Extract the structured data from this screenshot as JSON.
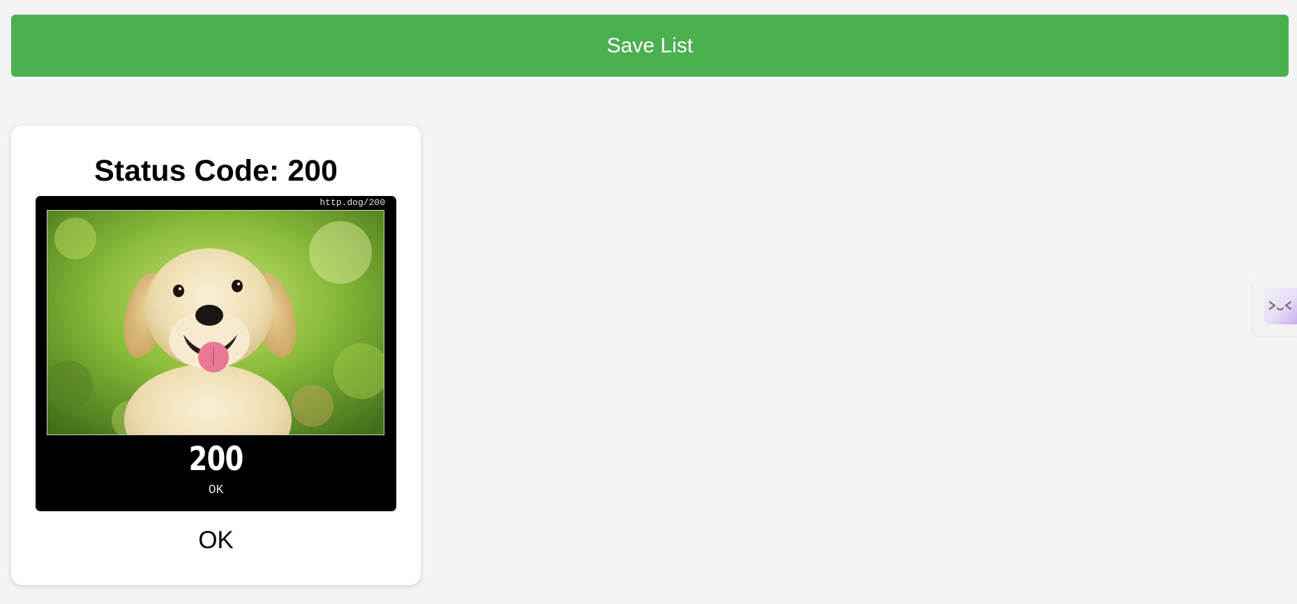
{
  "toolbar": {
    "save_label": "Save List"
  },
  "card": {
    "title": "Status Code: 200",
    "image": {
      "url_caption": "http.dog/200",
      "code": "200",
      "text": "OK"
    },
    "status_text": "OK"
  },
  "side_widget": {
    "icon": "face-icon"
  },
  "colors": {
    "accent": "#4caf50",
    "background": "#f4f4f4",
    "card": "#ffffff"
  }
}
